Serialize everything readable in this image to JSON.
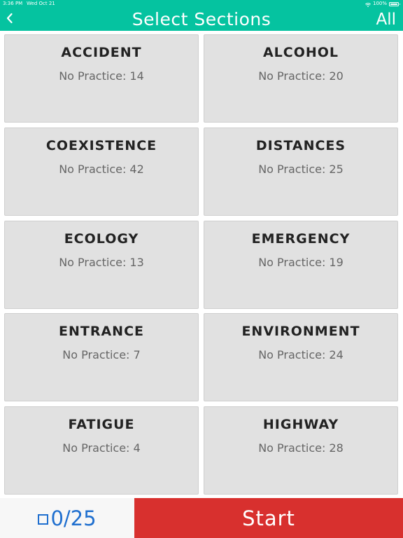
{
  "status_bar": {
    "time": "3:36 PM",
    "date": "Wed Oct 21",
    "battery": "100%"
  },
  "header": {
    "title": "Select Sections",
    "all_label": "All",
    "background": "#05c3a0"
  },
  "sections": [
    {
      "title": "ACCIDENT",
      "count": "No Practice: 14"
    },
    {
      "title": "ALCOHOL",
      "count": "No Practice: 20"
    },
    {
      "title": "COEXISTENCE",
      "count": "No Practice: 42"
    },
    {
      "title": "DISTANCES",
      "count": "No Practice: 25"
    },
    {
      "title": "ECOLOGY",
      "count": "No Practice: 13"
    },
    {
      "title": "EMERGENCY",
      "count": "No Practice: 19"
    },
    {
      "title": "ENTRANCE",
      "count": "No Practice: 7"
    },
    {
      "title": "ENVIRONMENT",
      "count": "No Practice: 24"
    },
    {
      "title": "FATIGUE",
      "count": "No Practice: 4"
    },
    {
      "title": "HIGHWAY",
      "count": "No Practice: 28"
    }
  ],
  "bottom_bar": {
    "counter": "0/25",
    "start_label": "Start",
    "start_color": "#d8302e",
    "counter_color": "#1f6fcf"
  }
}
